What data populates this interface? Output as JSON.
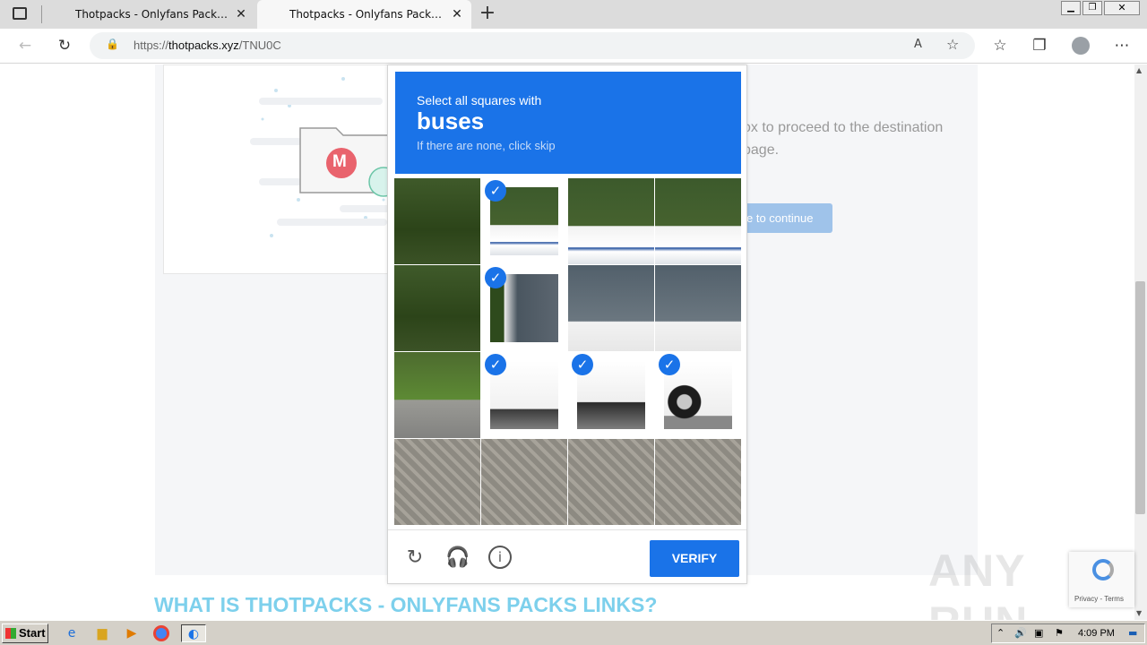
{
  "browser": {
    "tabs": [
      {
        "title": "Thotpacks - Onlyfans Packs Links"
      },
      {
        "title": "Thotpacks - Onlyfans Packs Links"
      }
    ],
    "url": {
      "scheme": "https://",
      "host": "thotpacks.xyz",
      "path": "/TNU0C"
    }
  },
  "page": {
    "instruction_text": "…ox to proceed to the destination page.",
    "instruction_line1": "ox to proceed to the destination",
    "instruction_line2": "page.",
    "continue_label": "e to continue",
    "heading": "WHAT IS THOTPACKS - ONLYFANS PACKS LINKS?",
    "card_icon_letter": "M"
  },
  "captcha": {
    "prompt": "Select all squares with",
    "target": "buses",
    "hint": "If there are none, click skip",
    "verify_label": "VERIFY",
    "selected_tiles": [
      1,
      5,
      9,
      10,
      11
    ],
    "tile_scenes": [
      "trees",
      "bus-roof",
      "bus-roof",
      "bus-roof",
      "trees",
      "bus-front",
      "bus-side",
      "bus-side",
      "grass-road",
      "bus-front-lower",
      "bus-mid",
      "bus-wheel",
      "cobble",
      "cobble",
      "cobble",
      "cobble"
    ]
  },
  "recaptcha_badge": {
    "text": "Privacy - Terms"
  },
  "watermark": "ANY RUN",
  "taskbar": {
    "start_label": "Start",
    "clock": "4:09 PM"
  },
  "colors": {
    "accent": "#1a73e8",
    "heading": "#7dd0ec",
    "continue": "#9fc3ea"
  }
}
